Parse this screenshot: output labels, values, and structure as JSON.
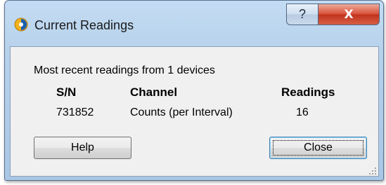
{
  "window": {
    "title": "Current Readings",
    "help_glyph": "?",
    "close_glyph": "X",
    "app_icon": "app-logo-icon"
  },
  "summary": {
    "text": "Most recent readings from 1 devices"
  },
  "table": {
    "columns": [
      "S/N",
      "Channel",
      "Readings"
    ],
    "rows": [
      {
        "sn": "731852",
        "channel": "Counts (per Interval)",
        "readings": "16"
      }
    ]
  },
  "buttons": {
    "help_label": "Help",
    "close_label": "Close"
  },
  "colors": {
    "close_accent": "#c2331d",
    "frame": "#b7d1eb"
  }
}
